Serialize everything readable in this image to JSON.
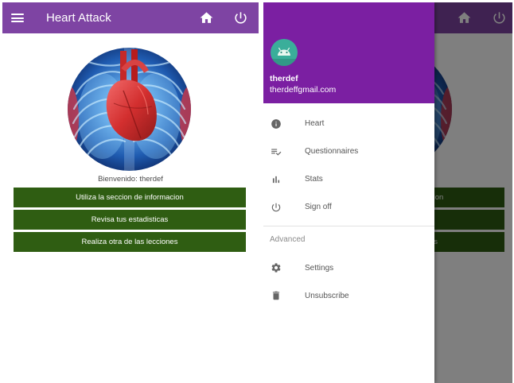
{
  "colors": {
    "app_bar": "#7e44a3",
    "drawer_header": "#7b1fa2",
    "button": "#2f5d12",
    "avatar": "#3aae9a"
  },
  "main_screen": {
    "app_bar": {
      "menu_icon": "hamburger-menu-icon",
      "title": "Heart Attack",
      "home_icon": "home-icon",
      "power_icon": "power-icon"
    },
    "welcome_text": "Bienvenido: therdef",
    "buttons": [
      {
        "label": "Utiliza la seccion de informacion"
      },
      {
        "label": "Revisa tus estadisticas"
      },
      {
        "label": "Realiza otra de las lecciones"
      }
    ]
  },
  "drawer": {
    "avatar_icon": "android-avatar-icon",
    "username": "therdef",
    "email": "therdeffgmail.com",
    "items": [
      {
        "icon": "info-icon",
        "label": "Heart"
      },
      {
        "icon": "playlist-check-icon",
        "label": "Questionnaires"
      },
      {
        "icon": "bar-chart-icon",
        "label": "Stats"
      },
      {
        "icon": "power-icon",
        "label": "Sign off"
      }
    ],
    "section_title": "Advanced",
    "advanced_items": [
      {
        "icon": "gear-icon",
        "label": "Settings"
      },
      {
        "icon": "trash-icon",
        "label": "Unsubscribe"
      }
    ]
  }
}
